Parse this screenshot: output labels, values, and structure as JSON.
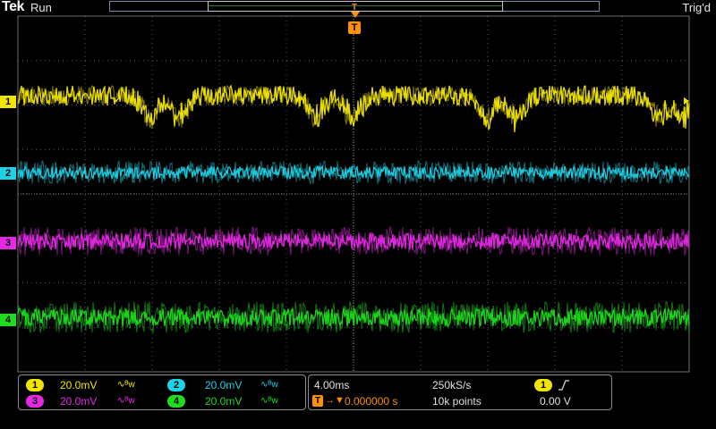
{
  "header": {
    "brand": "Tek",
    "run_state": "Run",
    "trigger_state": "Trig'd",
    "trigger_marker": "T"
  },
  "channels": [
    {
      "id": "1",
      "scale": "20.0mV",
      "bw": "∿ᴮw",
      "color": "#f2e600",
      "level": 0.88
    },
    {
      "id": "2",
      "scale": "20.0mV",
      "bw": "∿ᴮw",
      "color": "#1ed2e6",
      "level": 0.5
    },
    {
      "id": "3",
      "scale": "20.0mV",
      "bw": "∿ᴮw",
      "color": "#e628e6",
      "level": 0.5
    },
    {
      "id": "4",
      "scale": "20.0mV",
      "bw": "∿ᴮw",
      "color": "#1edc1e",
      "level": 0.5
    }
  ],
  "timebase": {
    "horizontal_scale": "4.00ms",
    "sample_rate": "250kS/s",
    "trigger_delay": "0.000000 s",
    "record_length": "10k points",
    "trigger_source": "1",
    "trigger_slope_icon": "rising-edge-icon",
    "trigger_level": "0.00 V"
  },
  "colors": {
    "trigger": "#ff9000",
    "grid": "#5a5a5a"
  }
}
